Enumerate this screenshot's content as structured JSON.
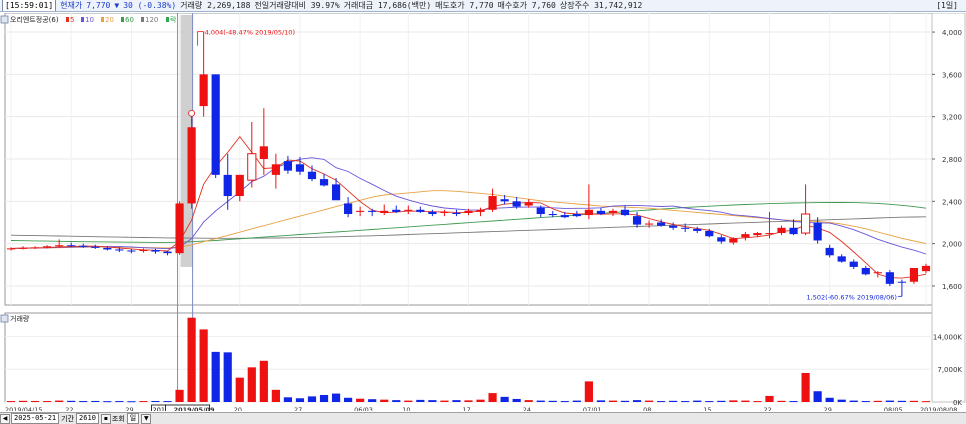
{
  "header": {
    "time": "[15:59:01]",
    "price_label": "현재가",
    "price": "7,770",
    "arrow": "▼",
    "change": "30 (-0.38%)",
    "volume": "거래량 2,269,188",
    "volume_ratio": "전일거래량대비 39.97%",
    "amount": "거래대금 17,686(백만)",
    "ask": "매도호가 7,770",
    "bid": "매수호가 7,760",
    "shares": "상장주수 31,742,912",
    "period": "[1일]"
  },
  "chart_data": {
    "type": "candlestick",
    "title": "오리엔트정공(6)",
    "legend": [
      "5",
      "10",
      "20",
      "60",
      "120",
      "락"
    ],
    "legend_colors": [
      "#e0301e",
      "#6a55d8",
      "#e8a040",
      "#3f9a50",
      "#7a7a7a",
      "#2fa84f"
    ],
    "y_ticks": [
      "4,000",
      "3,600",
      "3,200",
      "2,800",
      "2,400",
      "2,000",
      "1,600"
    ],
    "y_tick_values": [
      4000,
      3600,
      3200,
      2800,
      2400,
      2000,
      1600
    ],
    "ylim": [
      1420,
      4180
    ],
    "volume_title": "거래량",
    "volume_ticks": [
      "14,000K",
      "7,000K",
      "0K"
    ],
    "volume_tick_values": [
      14000,
      7000,
      0
    ],
    "volume_ylim": [
      0,
      19000
    ],
    "x_ticks": [
      {
        "i": 0,
        "label": "2019/04/15"
      },
      {
        "i": 5,
        "label": "22"
      },
      {
        "i": 10,
        "label": "29"
      },
      {
        "i": 14,
        "label": "2019/05/09"
      },
      {
        "i": 19,
        "label": "20"
      },
      {
        "i": 24,
        "label": "27"
      },
      {
        "i": 29,
        "label": "06/03"
      },
      {
        "i": 33,
        "label": "10"
      },
      {
        "i": 38,
        "label": "17"
      },
      {
        "i": 43,
        "label": "24"
      },
      {
        "i": 48,
        "label": "07/01"
      },
      {
        "i": 53,
        "label": "08"
      },
      {
        "i": 58,
        "label": "15"
      },
      {
        "i": 63,
        "label": "22"
      },
      {
        "i": 68,
        "label": "29"
      },
      {
        "i": 73,
        "label": "08/05"
      },
      {
        "i": 76,
        "label": "2019/08/08"
      }
    ],
    "cursor_x_label": "201",
    "highlight_index": 14,
    "cursor_index": 15,
    "annotation_high": "4,004(-48.47% 2019/05/10)",
    "annotation_high_index": 16,
    "annotation_high_value": 4004,
    "annotation_low": "1,502(-60.67% 2019/08/06)",
    "annotation_low_index": 74,
    "annotation_low_value": 1502,
    "marker_label": "락",
    "marker_index": 15,
    "candles": [
      [
        1950,
        1965,
        1935,
        1955
      ],
      [
        1955,
        1975,
        1945,
        1960
      ],
      [
        1960,
        1975,
        1950,
        1965
      ],
      [
        1965,
        1985,
        1955,
        1975
      ],
      [
        1975,
        2040,
        1965,
        1985
      ],
      [
        1985,
        2010,
        1965,
        1980
      ],
      [
        1980,
        2000,
        1960,
        1970
      ],
      [
        1970,
        1990,
        1950,
        1960
      ],
      [
        1960,
        1975,
        1935,
        1945
      ],
      [
        1945,
        1965,
        1920,
        1935
      ],
      [
        1935,
        1950,
        1910,
        1930
      ],
      [
        1930,
        1955,
        1915,
        1940
      ],
      [
        1940,
        1950,
        1905,
        1925
      ],
      [
        1925,
        1930,
        1890,
        1910
      ],
      [
        1910,
        2400,
        1895,
        2380
      ],
      [
        2380,
        3220,
        2330,
        3100
      ],
      [
        3300,
        4004,
        3200,
        3600
      ],
      [
        3600,
        3600,
        2620,
        2650
      ],
      [
        2650,
        2850,
        2320,
        2450
      ],
      [
        2450,
        2650,
        2400,
        2650
      ],
      [
        2600,
        3150,
        2530,
        2850
      ],
      [
        2800,
        3280,
        2650,
        2920
      ],
      [
        2650,
        2850,
        2520,
        2750
      ],
      [
        2780,
        2830,
        2660,
        2690
      ],
      [
        2750,
        2820,
        2650,
        2680
      ],
      [
        2680,
        2740,
        2590,
        2610
      ],
      [
        2610,
        2660,
        2540,
        2550
      ],
      [
        2560,
        2620,
        2420,
        2410
      ],
      [
        2380,
        2440,
        2250,
        2280
      ],
      [
        2300,
        2350,
        2260,
        2310
      ],
      [
        2310,
        2330,
        2260,
        2300
      ],
      [
        2290,
        2370,
        2270,
        2310
      ],
      [
        2320,
        2360,
        2290,
        2300
      ],
      [
        2310,
        2360,
        2280,
        2320
      ],
      [
        2320,
        2350,
        2290,
        2300
      ],
      [
        2300,
        2320,
        2260,
        2280
      ],
      [
        2290,
        2320,
        2260,
        2300
      ],
      [
        2290,
        2320,
        2260,
        2280
      ],
      [
        2290,
        2330,
        2270,
        2310
      ],
      [
        2300,
        2340,
        2260,
        2320
      ],
      [
        2320,
        2520,
        2300,
        2450
      ],
      [
        2420,
        2460,
        2370,
        2400
      ],
      [
        2400,
        2440,
        2330,
        2350
      ],
      [
        2360,
        2420,
        2340,
        2390
      ],
      [
        2340,
        2360,
        2250,
        2280
      ],
      [
        2280,
        2310,
        2250,
        2270
      ],
      [
        2270,
        2300,
        2240,
        2250
      ],
      [
        2280,
        2310,
        2250,
        2260
      ],
      [
        2270,
        2560,
        2230,
        2320
      ],
      [
        2310,
        2340,
        2270,
        2280
      ],
      [
        2290,
        2330,
        2260,
        2310
      ],
      [
        2320,
        2360,
        2260,
        2270
      ],
      [
        2260,
        2300,
        2150,
        2180
      ],
      [
        2180,
        2220,
        2150,
        2190
      ],
      [
        2200,
        2230,
        2160,
        2170
      ],
      [
        2170,
        2200,
        2130,
        2150
      ],
      [
        2150,
        2190,
        2110,
        2140
      ],
      [
        2140,
        2160,
        2100,
        2120
      ],
      [
        2120,
        2140,
        2060,
        2070
      ],
      [
        2060,
        2080,
        2000,
        2020
      ],
      [
        2010,
        2060,
        1990,
        2050
      ],
      [
        2060,
        2110,
        2030,
        2090
      ],
      [
        2080,
        2110,
        2060,
        2100
      ],
      [
        2090,
        2300,
        2050,
        2100
      ],
      [
        2100,
        2170,
        2080,
        2150
      ],
      [
        2150,
        2230,
        2080,
        2090
      ],
      [
        2100,
        2560,
        2080,
        2280
      ],
      [
        2200,
        2250,
        2000,
        2030
      ],
      [
        1960,
        1990,
        1870,
        1890
      ],
      [
        1880,
        1900,
        1820,
        1830
      ],
      [
        1830,
        1850,
        1760,
        1780
      ],
      [
        1770,
        1790,
        1700,
        1710
      ],
      [
        1720,
        1740,
        1680,
        1730
      ],
      [
        1730,
        1750,
        1600,
        1620
      ],
      [
        1640,
        1660,
        1502,
        1640
      ],
      [
        1640,
        1770,
        1620,
        1770
      ],
      [
        1740,
        1810,
        1720,
        1790
      ]
    ],
    "volumes": [
      200,
      250,
      220,
      200,
      300,
      250,
      200,
      220,
      180,
      200,
      170,
      200,
      210,
      200,
      2600,
      18000,
      15500,
      10700,
      10600,
      5200,
      7400,
      8800,
      2600,
      1000,
      800,
      1200,
      1500,
      1800,
      900,
      700,
      600,
      500,
      400,
      300,
      450,
      400,
      300,
      400,
      350,
      500,
      1900,
      1100,
      650,
      400,
      300,
      250,
      200,
      300,
      4400,
      350,
      300,
      250,
      400,
      300,
      200,
      250,
      200,
      300,
      200,
      250,
      350,
      300,
      200,
      1300,
      250,
      200,
      6200,
      2300,
      900,
      500,
      300,
      200,
      250,
      300,
      250,
      250,
      180
    ],
    "ma5": [
      1955,
      1958,
      1960,
      1963,
      1968,
      1973,
      1977,
      1976,
      1969,
      1959,
      1950,
      1942,
      1937,
      1930,
      2022,
      2222,
      2561,
      2731,
      2862,
      3011,
      2862,
      2710,
      2718,
      2790,
      2781,
      2708,
      2658,
      2600,
      2499,
      2398,
      2316,
      2292,
      2298,
      2308,
      2307,
      2302,
      2299,
      2295,
      2293,
      2310,
      2350,
      2374,
      2382,
      2390,
      2385,
      2329,
      2290,
      2280,
      2280,
      2278,
      2281,
      2283,
      2271,
      2237,
      2207,
      2181,
      2160,
      2144,
      2126,
      2088,
      2048,
      2055,
      2066,
      2081,
      2113,
      2128,
      2175,
      2148,
      2106,
      2020,
      1922,
      1819,
      1713,
      1678,
      1674,
      1688,
      1711
    ],
    "ma10": [
      1955,
      1957,
      1959,
      1961,
      1964,
      1968,
      1970,
      1971,
      1972,
      1972,
      1968,
      1962,
      1957,
      1952,
      1966,
      2048,
      2204,
      2309,
      2399,
      2489,
      2586,
      2637,
      2717,
      2763,
      2798,
      2812,
      2796,
      2718,
      2682,
      2617,
      2561,
      2502,
      2448,
      2413,
      2381,
      2356,
      2337,
      2327,
      2319,
      2316,
      2334,
      2339,
      2344,
      2345,
      2347,
      2339,
      2333,
      2334,
      2335,
      2339,
      2355,
      2360,
      2361,
      2357,
      2351,
      2355,
      2337,
      2322,
      2312,
      2297,
      2273,
      2263,
      2252,
      2238,
      2225,
      2209,
      2201,
      2196,
      2194,
      2166,
      2132,
      2088,
      2041,
      2003,
      1967,
      1938,
      1902
    ],
    "ma20": [
      1955,
      1957,
      1958,
      1960,
      1962,
      1964,
      1966,
      1967,
      1967,
      1967,
      1965,
      1963,
      1962,
      1960,
      1968,
      1988,
      2018,
      2048,
      2078,
      2108,
      2140,
      2170,
      2200,
      2230,
      2260,
      2290,
      2320,
      2350,
      2380,
      2410,
      2440,
      2460,
      2470,
      2480,
      2490,
      2500,
      2500,
      2495,
      2485,
      2475,
      2465,
      2450,
      2435,
      2420,
      2405,
      2395,
      2385,
      2375,
      2365,
      2355,
      2350,
      2345,
      2340,
      2335,
      2325,
      2315,
      2305,
      2295,
      2285,
      2275,
      2265,
      2255,
      2245,
      2235,
      2225,
      2220,
      2215,
      2210,
      2200,
      2185,
      2165,
      2140,
      2110,
      2080,
      2050,
      2025,
      2000
    ],
    "ma60": [
      2030,
      2028,
      2026,
      2024,
      2022,
      2020,
      2018,
      2017,
      2016,
      2015,
      2014,
      2013,
      2012,
      2012,
      2014,
      2018,
      2024,
      2030,
      2038,
      2046,
      2054,
      2062,
      2070,
      2078,
      2086,
      2094,
      2102,
      2110,
      2118,
      2126,
      2134,
      2142,
      2150,
      2158,
      2166,
      2174,
      2182,
      2190,
      2198,
      2206,
      2214,
      2222,
      2230,
      2238,
      2246,
      2254,
      2262,
      2270,
      2278,
      2286,
      2294,
      2302,
      2310,
      2318,
      2326,
      2334,
      2342,
      2348,
      2354,
      2360,
      2365,
      2370,
      2374,
      2378,
      2381,
      2384,
      2386,
      2388,
      2389,
      2389,
      2388,
      2385,
      2380,
      2372,
      2362,
      2350,
      2335
    ],
    "ma120": [
      2080,
      2078,
      2076,
      2074,
      2072,
      2070,
      2068,
      2066,
      2064,
      2062,
      2060,
      2058,
      2056,
      2054,
      2053,
      2052,
      2051,
      2050,
      2050,
      2050,
      2051,
      2052,
      2053,
      2055,
      2057,
      2059,
      2062,
      2065,
      2068,
      2071,
      2074,
      2078,
      2082,
      2086,
      2090,
      2094,
      2098,
      2102,
      2106,
      2110,
      2114,
      2118,
      2122,
      2126,
      2130,
      2134,
      2138,
      2142,
      2146,
      2150,
      2154,
      2158,
      2162,
      2166,
      2170,
      2174,
      2178,
      2182,
      2186,
      2190,
      2194,
      2198,
      2202,
      2206,
      2210,
      2214,
      2218,
      2222,
      2226,
      2230,
      2234,
      2238,
      2242,
      2246,
      2250,
      2252,
      2254
    ]
  },
  "statusbar": {
    "date": "2025-05-21",
    "period_label": "기간",
    "count": "2610",
    "view_label": "조회",
    "unit": "일"
  }
}
